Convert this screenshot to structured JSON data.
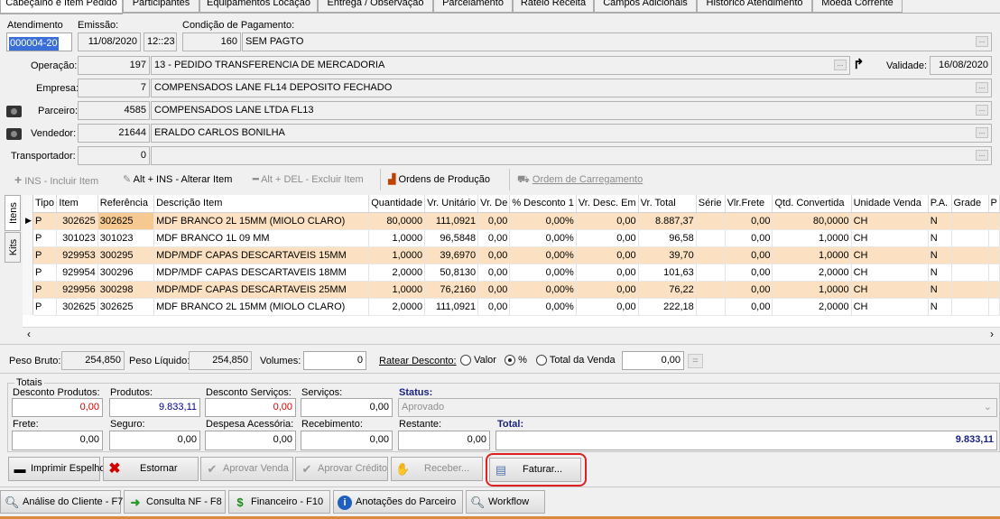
{
  "tabs": [
    "Cabeçalho e Item Pedido",
    "Participantes",
    "Equipamentos Locação",
    "Entrega / Observação",
    "Parcelamento",
    "Rateio Receita",
    "Campos Adicionais",
    "Histórico Atendimento",
    "Moeda Corrente"
  ],
  "header": {
    "atendimento_label": "Atendimento",
    "atendimento": "000004-20",
    "emissao_label": "Emissão:",
    "emissao_date": "11/08/2020",
    "emissao_time": "12::23",
    "cond_label": "Condição de Pagamento:",
    "cond_code": "160",
    "cond_desc": "SEM PAGTO",
    "operacao_label": "Operação:",
    "operacao_code": "197",
    "operacao_desc": "13 - PEDIDO TRANSFERENCIA DE MERCADORIA",
    "validade_label": "Validade:",
    "validade": "16/08/2020",
    "empresa_label": "Empresa:",
    "empresa_code": "7",
    "empresa_desc": "COMPENSADOS LANE FL14 DEPOSITO FECHADO",
    "parceiro_label": "Parceiro:",
    "parceiro_code": "4585",
    "parceiro_desc": "COMPENSADOS LANE LTDA FL13",
    "vendedor_label": "Vendedor:",
    "vendedor_code": "21644",
    "vendedor_desc": "ERALDO CARLOS BONILHA",
    "transportador_label": "Transportador:",
    "transportador_code": "0",
    "transportador_desc": ""
  },
  "toolbar": {
    "incluir": "INS - Incluir Item",
    "alterar": "Alt + INS - Alterar Item",
    "excluir": "Alt + DEL - Excluir Item",
    "ordens_producao": "Ordens de Produção",
    "ordem_carregamento": "Ordem de Carregamento"
  },
  "side_tabs": {
    "itens": "Itens",
    "kits": "Kits"
  },
  "grid": {
    "columns": [
      "Tipo",
      "Item",
      "Referência",
      "Descrição Item",
      "Quantidade",
      "Vr. Unitário",
      "Vr. De",
      "% Desconto 1",
      "Vr. Desc. Em",
      "Vr. Total",
      "Série",
      "Vlr.Frete",
      "Qtd. Convertida",
      "Unidade Venda",
      "P.A.",
      "Grade",
      "P"
    ],
    "rows": [
      [
        "P",
        "302625",
        "302625",
        "MDF BRANCO 2L 15MM (MIOLO CLARO)",
        "80,0000",
        "111,0921",
        "0,00",
        "0,00%",
        "0,00",
        "8.887,37",
        "",
        "0,00",
        "80,0000",
        "CH",
        "N",
        "",
        ""
      ],
      [
        "P",
        "301023",
        "301023",
        "MDF BRANCO 1L 09 MM",
        "1,0000",
        "96,5848",
        "0,00",
        "0,00%",
        "0,00",
        "96,58",
        "",
        "0,00",
        "1,0000",
        "CH",
        "N",
        "",
        ""
      ],
      [
        "P",
        "929953",
        "300295",
        "MDP/MDF CAPAS DESCARTAVEIS 15MM",
        "1,0000",
        "39,6970",
        "0,00",
        "0,00%",
        "0,00",
        "39,70",
        "",
        "0,00",
        "1,0000",
        "CH",
        "N",
        "",
        ""
      ],
      [
        "P",
        "929954",
        "300296",
        "MDP/MDF CAPAS DESCARTAVEIS 18MM",
        "2,0000",
        "50,8130",
        "0,00",
        "0,00%",
        "0,00",
        "101,63",
        "",
        "0,00",
        "2,0000",
        "CH",
        "N",
        "",
        ""
      ],
      [
        "P",
        "929956",
        "300298",
        "MDP/MDF CAPAS DESCARTAVEIS 25MM",
        "1,0000",
        "76,2160",
        "0,00",
        "0,00%",
        "0,00",
        "76,22",
        "",
        "0,00",
        "1,0000",
        "CH",
        "N",
        "",
        ""
      ],
      [
        "P",
        "302625",
        "302625",
        "MDF BRANCO 2L 15MM (MIOLO CLARO)",
        "2,0000",
        "111,0921",
        "0,00",
        "0,00%",
        "0,00",
        "222,18",
        "",
        "0,00",
        "2,0000",
        "CH",
        "N",
        "",
        ""
      ]
    ]
  },
  "weights": {
    "peso_bruto_label": "Peso Bruto:",
    "peso_bruto": "254,850",
    "peso_liquido_label": "Peso Líquido:",
    "peso_liquido": "254,850",
    "volumes_label": "Volumes:",
    "volumes": "0",
    "ratear_label": "Ratear Desconto:",
    "opt_valor": "Valor",
    "opt_pct": "%",
    "opt_total": "Total da Venda",
    "ratear_value": "0,00",
    "ratear_btn": "="
  },
  "totais": {
    "title": "Totais",
    "desc_produtos_label": "Desconto Produtos:",
    "desc_produtos": "0,00",
    "produtos_label": "Produtos:",
    "produtos": "9.833,11",
    "desc_servicos_label": "Desconto Serviços:",
    "desc_servicos": "0,00",
    "servicos_label": "Serviços:",
    "servicos": "0,00",
    "status_label": "Status:",
    "status": "Aprovado",
    "frete_label": "Frete:",
    "frete": "0,00",
    "seguro_label": "Seguro:",
    "seguro": "0,00",
    "despesa_label": "Despesa Acessória:",
    "despesa": "0,00",
    "recebimento_label": "Recebimento:",
    "recebimento": "0,00",
    "restante_label": "Restante:",
    "restante": "0,00",
    "total_label": "Total:",
    "total": "9.833,11"
  },
  "actions": {
    "imprimir": "Imprimir Espelho",
    "estornar": "Estornar",
    "aprovar_venda": "Aprovar Venda",
    "aprovar_credito": "Aprovar Crédito",
    "receber": "Receber...",
    "faturar": "Faturar..."
  },
  "footer": {
    "analise": "Análise do Cliente - F7",
    "consulta": "Consulta NF - F8",
    "financeiro": "Financeiro - F10",
    "anotacoes": "Anotações do Parceiro",
    "workflow": "Workflow"
  },
  "colors": {
    "row_alt": "#fbe1c2",
    "selection": "#3a6fd8",
    "highlight": "#e02020",
    "negative": "#d00000",
    "total_blue": "#00008b"
  }
}
